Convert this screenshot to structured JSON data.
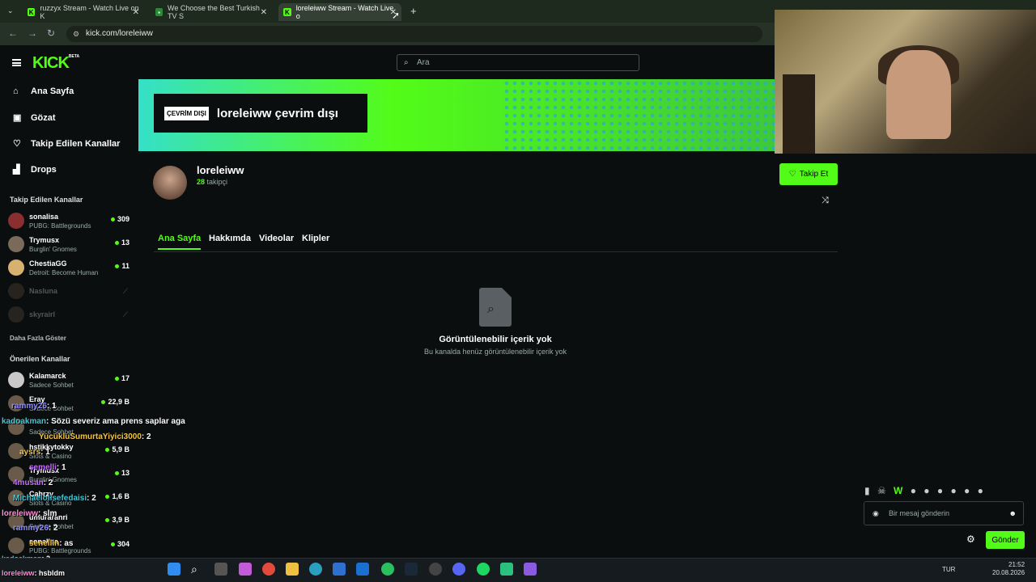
{
  "browser": {
    "tabs": [
      {
        "title": "ruzzyx Stream - Watch Live on K"
      },
      {
        "title": "We Choose the Best Turkish TV S"
      },
      {
        "title": "loreleiww Stream - Watch Live o"
      }
    ],
    "url": "kick.com/loreleiww"
  },
  "site": {
    "logo": "KICK",
    "logo_badge": "BETA",
    "search_placeholder": "Ara"
  },
  "nav": [
    {
      "label": "Ana Sayfa",
      "icon": "home-icon"
    },
    {
      "label": "Gözat",
      "icon": "browse-icon"
    },
    {
      "label": "Takip Edilen Kanallar",
      "icon": "heart-icon"
    },
    {
      "label": "Drops",
      "icon": "drops-icon"
    }
  ],
  "followed": {
    "heading": "Takip Edilen Kanallar",
    "channels": [
      {
        "name": "sonalisa",
        "game": "PUBG: Battlegrounds",
        "viewers": "309"
      },
      {
        "name": "Trymusx",
        "game": "Burglin' Gnomes",
        "viewers": "13"
      },
      {
        "name": "ChestiaGG",
        "game": "Detroit: Become Human",
        "viewers": "11"
      },
      {
        "name": "Nasluna",
        "game": "",
        "viewers": ""
      },
      {
        "name": "skyrairl",
        "game": "",
        "viewers": ""
      }
    ],
    "show_more": "Daha Fazla Göster"
  },
  "recommended": {
    "heading": "Önerilen Kanallar",
    "channels": [
      {
        "name": "Kalamarck",
        "game": "Sadece Sohbet",
        "viewers": "17"
      },
      {
        "name": "Eray",
        "game": "Sadece Sohbet",
        "viewers": "22,9 B"
      },
      {
        "name": "",
        "game": "Sadece Sohbet",
        "viewers": ""
      },
      {
        "name": "hstikkytokky",
        "game": "Slots & Casino",
        "viewers": "5,9 B"
      },
      {
        "name": "Trymusx",
        "game": "Burglin' Gnomes",
        "viewers": "13"
      },
      {
        "name": "Cahrzy",
        "game": "Slots & Casino",
        "viewers": "1,6 B"
      },
      {
        "name": "umuraranri",
        "game": "Sadece Sohbet",
        "viewers": "3,9 B"
      },
      {
        "name": "sonalisa",
        "game": "PUBG: Battlegrounds",
        "viewers": "304"
      }
    ]
  },
  "banner": {
    "badge": "ÇEVRİM DIŞI",
    "text": "loreleiww çevrim dışı"
  },
  "profile": {
    "name": "loreleiww",
    "followers_count": "28",
    "followers_label": "takipçi",
    "follow_button": "Takip Et"
  },
  "profile_tabs": [
    "Ana Sayfa",
    "Hakkımda",
    "Videolar",
    "Klipler"
  ],
  "empty_state": {
    "title": "Görüntülenebilir içerik yok",
    "subtitle": "Bu kanalda henüz görüntülenebilir içerik yok"
  },
  "overlay_chat": [
    {
      "user": "rammy26",
      "msg": ": 1",
      "color": "#8f8cff"
    },
    {
      "user": "kadoakman",
      "msg": ": Sözü severiz ama prens saplar aga",
      "color": "#3ec8d8"
    },
    {
      "user": "YucukluSumurtaYiyici3000",
      "msg": ": 2",
      "color": "#f4c542"
    },
    {
      "user": "aysrs",
      "msg": ": 1",
      "color": "#f4c542"
    },
    {
      "user": "semelli",
      "msg": ": 1",
      "color": "#c76bff"
    },
    {
      "user": "4musan",
      "msg": ": 2",
      "color": "#c76bff"
    },
    {
      "user": "Michaelolisefedaisi",
      "msg": ": 2",
      "color": "#3ec8d8"
    },
    {
      "user": "loreleiww",
      "msg": ": slm",
      "color": "#ff8ad8"
    },
    {
      "user": "rammy26",
      "msg": ": 2",
      "color": "#8f8cff"
    },
    {
      "user": "senellin",
      "msg": ": as",
      "color": "#f4c542"
    },
    {
      "user": "kadoakman",
      "msg": ": 2",
      "color": "#3ec8d8"
    },
    {
      "user": "loreleiww",
      "msg": ": hsbldm",
      "color": "#ff8ad8"
    }
  ],
  "chat": {
    "placeholder": "Bir mesaj gönderin",
    "send_button": "Gönder"
  },
  "taskbar": {
    "lang": "TUR",
    "time": "21:52",
    "date": "20.08.2026"
  },
  "colors": {
    "accent": "#53fc18",
    "background": "#0b0e0f"
  }
}
